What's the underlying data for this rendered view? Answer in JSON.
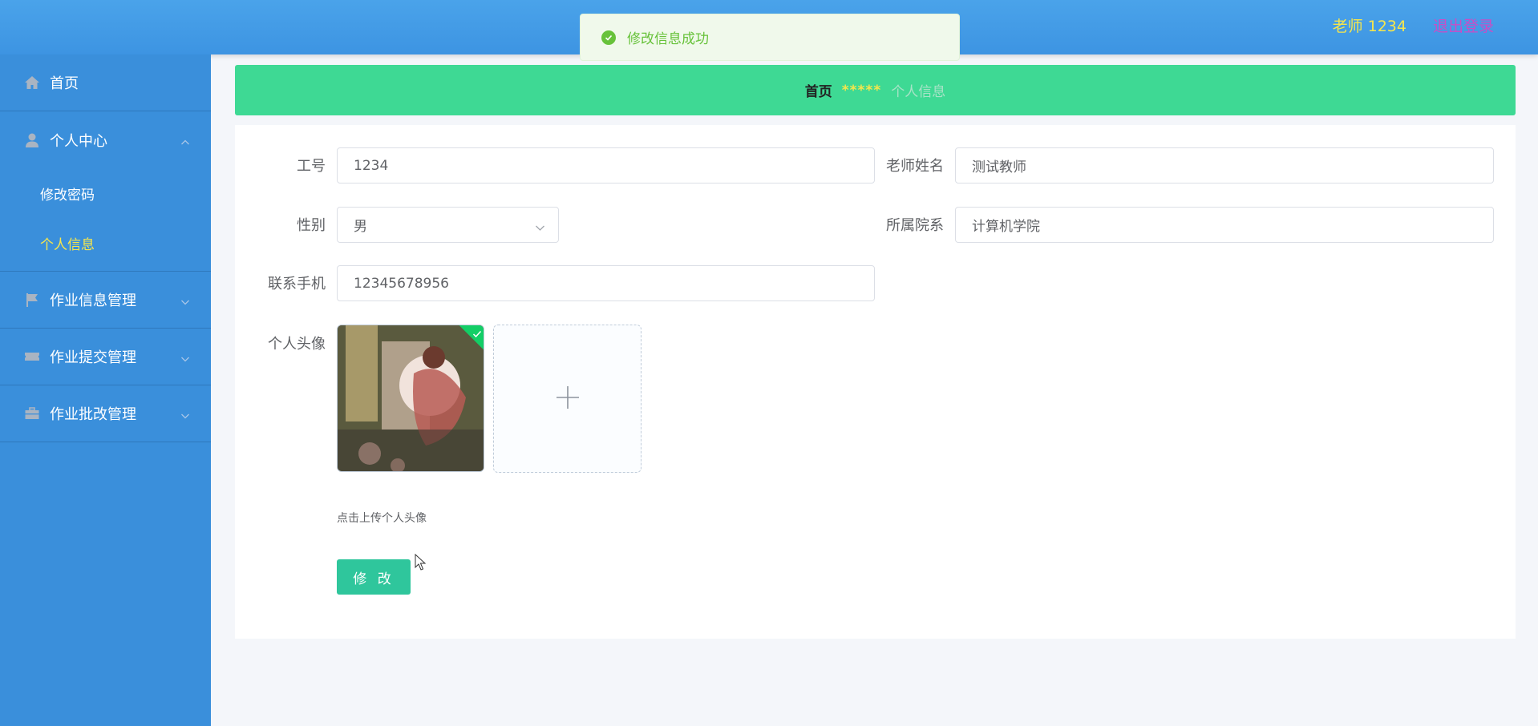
{
  "header": {
    "user": "老师 1234",
    "logout": "退出登录"
  },
  "toast": {
    "message": "修改信息成功"
  },
  "sidebar": {
    "items": [
      {
        "label": "首页",
        "icon": "home-icon"
      },
      {
        "label": "个人中心",
        "icon": "user-icon",
        "expanded": true,
        "children": [
          {
            "label": "修改密码"
          },
          {
            "label": "个人信息",
            "active": true
          }
        ]
      },
      {
        "label": "作业信息管理",
        "icon": "flag-icon"
      },
      {
        "label": "作业提交管理",
        "icon": "ticket-icon"
      },
      {
        "label": "作业批改管理",
        "icon": "briefcase-icon"
      }
    ]
  },
  "breadcrumb": {
    "home": "首页",
    "separator": "*****",
    "current": "个人信息"
  },
  "form": {
    "job_no_label": "工号",
    "job_no_value": "1234",
    "teacher_name_label": "老师姓名",
    "teacher_name_value": "测试教师",
    "gender_label": "性别",
    "gender_value": "男",
    "department_label": "所属院系",
    "department_value": "计算机学院",
    "phone_label": "联系手机",
    "phone_value": "12345678956",
    "avatar_label": "个人头像",
    "upload_tip": "点击上传个人头像",
    "submit_label": "修 改"
  },
  "colors": {
    "header_bg": "#4aa3ea",
    "sidebar_bg": "#3a8fdb",
    "breadcrumb_bg": "#3ed994",
    "accent_yellow": "#f7e64b",
    "logout_purple": "#c84ec6",
    "success_green": "#67c23a",
    "submit_bg": "#2fc69c"
  }
}
